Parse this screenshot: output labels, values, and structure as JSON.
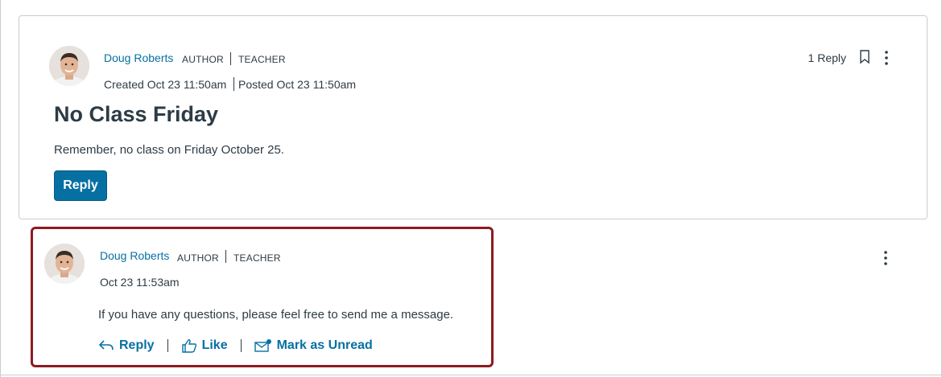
{
  "topic": {
    "author_name": "Doug Roberts",
    "role_primary": "AUTHOR",
    "role_secondary": "TEACHER",
    "created": "Created Oct 23 11:50am",
    "posted": "Posted Oct 23 11:50am",
    "title": "No Class Friday",
    "body": "Remember, no class on Friday October 25.",
    "reply_button_label": "Reply",
    "reply_count": "1 Reply",
    "icons": [
      "avatar",
      "bookmark-icon",
      "kebab-menu-icon"
    ]
  },
  "reply": {
    "author_name": "Doug Roberts",
    "role_primary": "AUTHOR",
    "role_secondary": "TEACHER",
    "timestamp": "Oct 23 11:53am",
    "body": "If you have any questions, please feel free to send me a message.",
    "actions": {
      "reply_label": "Reply",
      "like_label": "Like",
      "mark_unread_label": "Mark as Unread"
    },
    "icons": [
      "avatar",
      "reply-arrow-icon",
      "thumbs-up-icon",
      "envelope-icon",
      "kebab-menu-icon"
    ]
  },
  "colors": {
    "link": "#0770a3",
    "text": "#2d3b45",
    "border": "#c7cdd1",
    "highlight": "#8e1b21",
    "button": "#0770a3"
  }
}
